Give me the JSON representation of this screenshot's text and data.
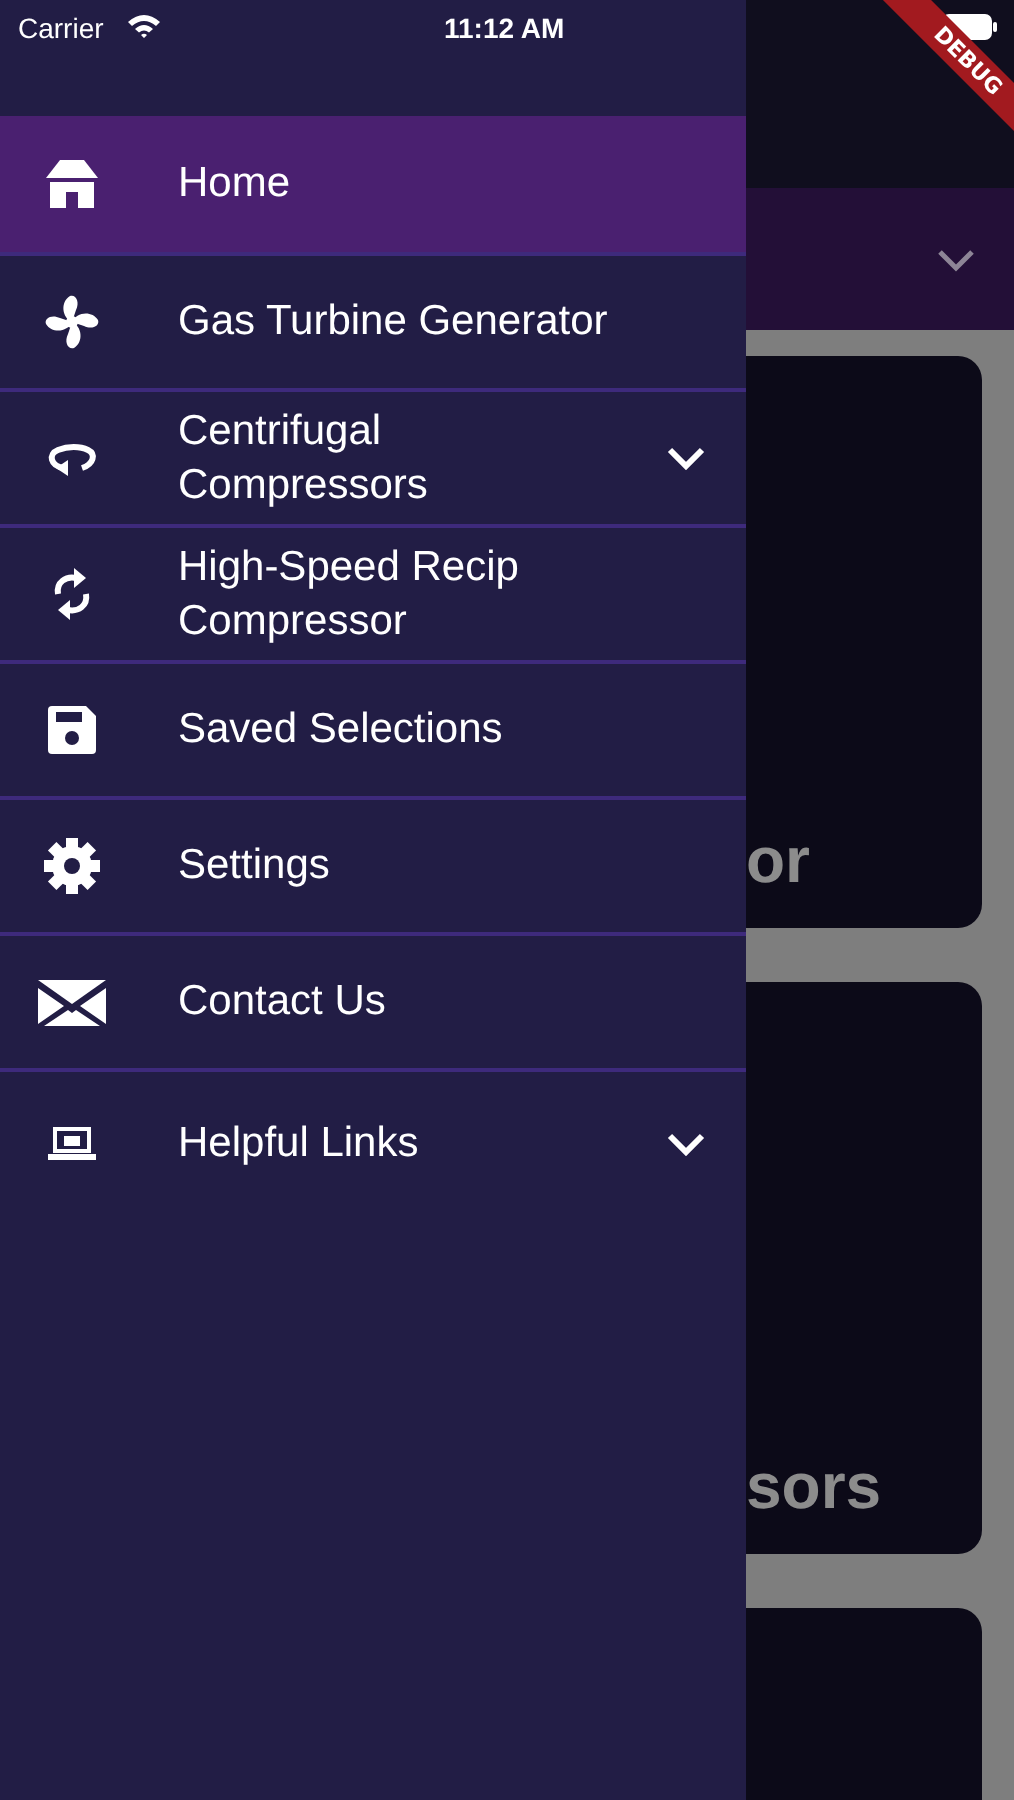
{
  "status_bar": {
    "carrier": "Carrier",
    "time": "11:12 AM"
  },
  "debug_banner": "DEBUG",
  "drawer": {
    "items": [
      {
        "label": "Home",
        "selected": true
      },
      {
        "label": "Gas Turbine Generator",
        "selected": false
      },
      {
        "label": "Centrifugal Compressors",
        "selected": false,
        "expanded": false
      },
      {
        "label": "High-Speed Recip Compressor",
        "selected": false
      },
      {
        "label": "Saved Selections",
        "selected": false
      },
      {
        "label": "Settings",
        "selected": false
      },
      {
        "label": "Contact Us",
        "selected": false
      },
      {
        "label": "Helpful Links",
        "selected": false,
        "expanded": false
      }
    ]
  },
  "background": {
    "cards": [
      {
        "title": "or"
      },
      {
        "title": "sors"
      }
    ]
  }
}
